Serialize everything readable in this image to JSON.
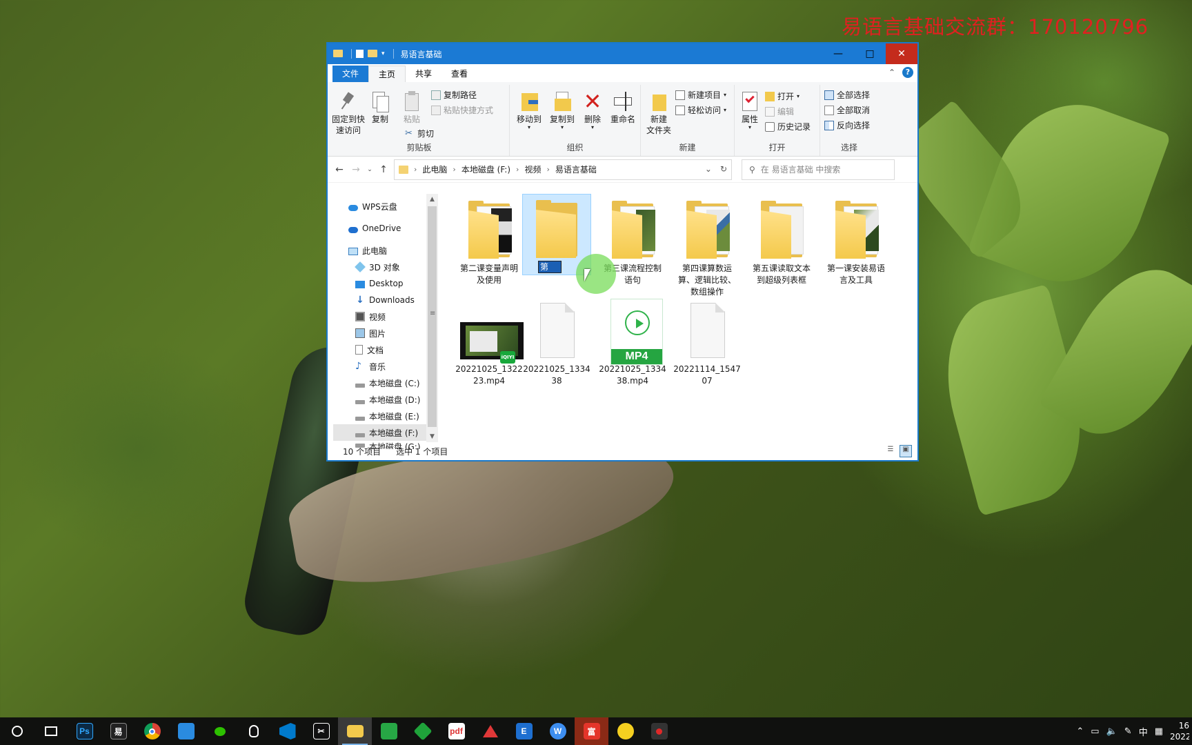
{
  "watermark": "易语言基础交流群：170120796",
  "window": {
    "title": "易语言基础",
    "tabs": {
      "file": "文件",
      "home": "主页",
      "share": "共享",
      "view": "查看"
    },
    "help": "?"
  },
  "ribbon": {
    "clipboard": {
      "label": "剪贴板",
      "pin": "固定到快\n速访问",
      "copy": "复制",
      "paste": "粘贴",
      "copy_path": "复制路径",
      "paste_shortcut": "粘贴快捷方式",
      "cut": "剪切"
    },
    "organize": {
      "label": "组织",
      "move_to": "移动到",
      "copy_to": "复制到",
      "delete": "删除",
      "rename": "重命名"
    },
    "new": {
      "label": "新建",
      "new_folder": "新建\n文件夹",
      "new_item": "新建项目",
      "easy_access": "轻松访问"
    },
    "open": {
      "label": "打开",
      "properties": "属性",
      "open": "打开",
      "edit": "编辑",
      "history": "历史记录"
    },
    "select": {
      "label": "选择",
      "select_all": "全部选择",
      "select_none": "全部取消",
      "invert": "反向选择"
    }
  },
  "address": {
    "crumbs": [
      "此电脑",
      "本地磁盘 (F:)",
      "视频",
      "易语言基础"
    ],
    "search_placeholder": "在 易语言基础 中搜索"
  },
  "nav": [
    {
      "label": "WPS云盘",
      "icon": "cloud-icon"
    },
    {
      "label": "OneDrive",
      "icon": "cloud-icon"
    },
    {
      "label": "此电脑",
      "icon": "computer-icon"
    },
    {
      "label": "3D 对象",
      "icon": "cube-icon"
    },
    {
      "label": "Desktop",
      "icon": "desktop-icon"
    },
    {
      "label": "Downloads",
      "icon": "download-icon"
    },
    {
      "label": "视频",
      "icon": "video-icon"
    },
    {
      "label": "图片",
      "icon": "picture-icon"
    },
    {
      "label": "文档",
      "icon": "document-icon"
    },
    {
      "label": "音乐",
      "icon": "music-icon"
    },
    {
      "label": "本地磁盘 (C:)",
      "icon": "drive-icon"
    },
    {
      "label": "本地磁盘 (D:)",
      "icon": "drive-icon"
    },
    {
      "label": "本地磁盘 (E:)",
      "icon": "drive-icon"
    },
    {
      "label": "本地磁盘 (F:)",
      "icon": "drive-icon"
    },
    {
      "label": "本地磁盘 (G:)",
      "icon": "drive-icon"
    }
  ],
  "files": [
    {
      "name": "第二课变量声明\n及使用",
      "type": "folder"
    },
    {
      "name": "第",
      "type": "folder",
      "renaming": true
    },
    {
      "name": "第三课流程控制\n语句",
      "type": "folder"
    },
    {
      "name": "第四课算数运\n算、逻辑比较、\n数组操作",
      "type": "folder"
    },
    {
      "name": "第五课读取文本\n到超级列表框",
      "type": "folder"
    },
    {
      "name": "第一课安装易语\n言及工具",
      "type": "folder"
    },
    {
      "name": "20221025_1322\n23.mp4",
      "type": "video-thumb",
      "badge": "iQIYI"
    },
    {
      "name": "20221025_1334\n38",
      "type": "blank"
    },
    {
      "name": "20221025_1334\n38.mp4",
      "type": "mp4",
      "badge": "MP4"
    },
    {
      "name": "20221114_1547\n07",
      "type": "blank"
    }
  ],
  "status": {
    "count": "10 个项目",
    "selected": "选中 1 个项目"
  },
  "taskbar": {
    "apps": [
      "search",
      "task-view",
      "photoshop",
      "easy-language",
      "chrome",
      "remote",
      "wechat",
      "qq",
      "vscode",
      "capcut",
      "explorer",
      "green-app",
      "green-diamond",
      "pdf",
      "red-a",
      "blue-e",
      "wps",
      "fu",
      "yellow-app",
      "recorder"
    ],
    "ime": "中",
    "time": "16",
    "date": "2022"
  },
  "colors": {
    "titlebar": "#1b7ad4",
    "taskbar": "#10110f",
    "selection": "#cce8ff",
    "watermark": "#e02020"
  }
}
